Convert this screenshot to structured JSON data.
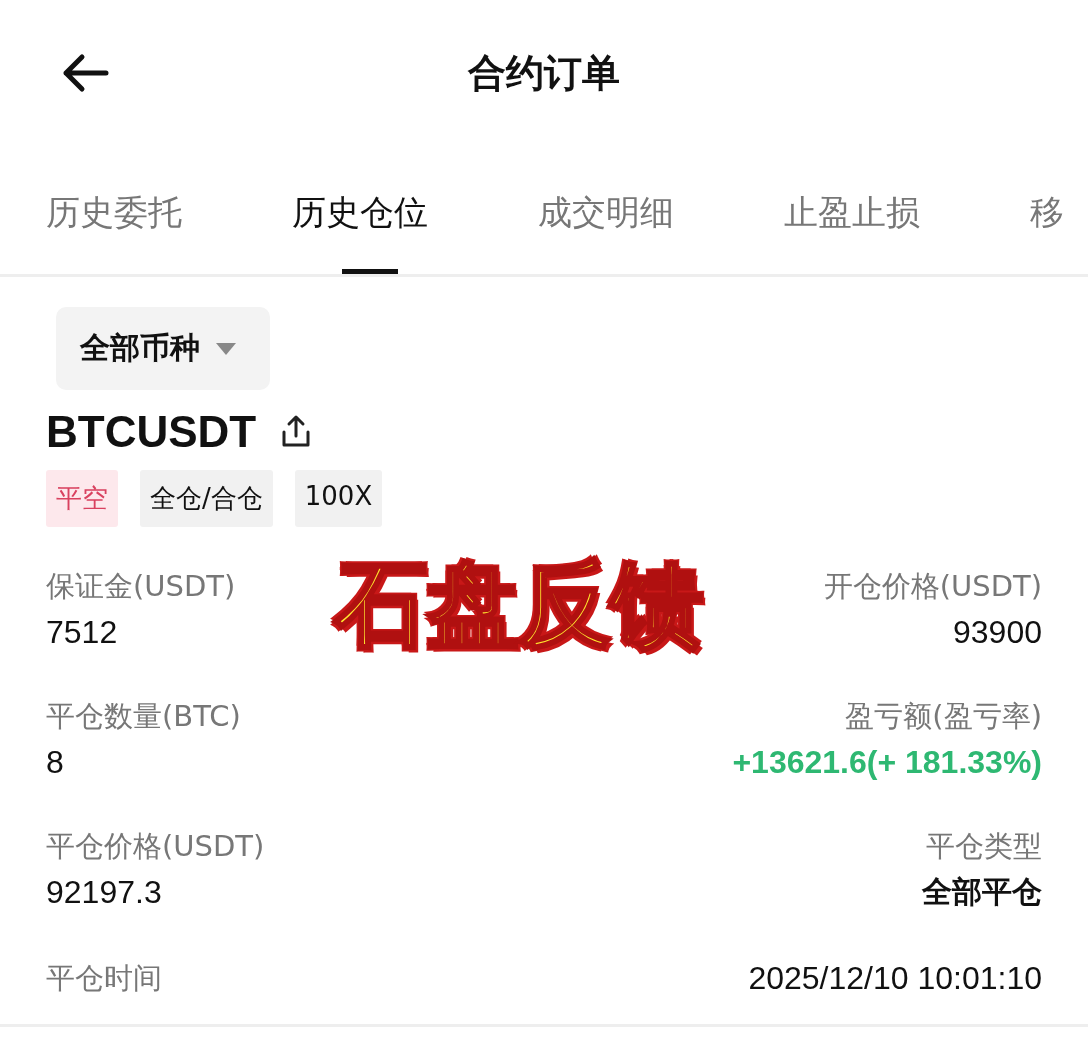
{
  "header": {
    "title": "合约订单"
  },
  "tabs": [
    {
      "label": "历史委托",
      "selected": false
    },
    {
      "label": "历史仓位",
      "selected": true
    },
    {
      "label": "成交明细",
      "selected": false
    },
    {
      "label": "止盈止损",
      "selected": false
    },
    {
      "label": "移",
      "selected": false
    }
  ],
  "filter": {
    "label": "全部币种"
  },
  "position": {
    "symbol": "BTCUSDT",
    "tags": [
      {
        "label": "平空",
        "kind": "side"
      },
      {
        "label": "全仓/合仓",
        "kind": "plain"
      },
      {
        "label": "100X",
        "kind": "plain"
      }
    ],
    "fields": [
      {
        "label": "保证金(USDT)",
        "value": "7512",
        "kind": "plain"
      },
      {
        "label": "开仓价格(USDT)",
        "value": "93900",
        "kind": "plain"
      },
      {
        "label": "平仓数量(BTC)",
        "value": "8",
        "kind": "plain"
      },
      {
        "label": "盈亏额(盈亏率)",
        "value": "+13621.6(+ 181.33%)",
        "kind": "gain"
      },
      {
        "label": "平仓价格(USDT)",
        "value": "92197.3",
        "kind": "plain"
      },
      {
        "label": "平仓类型",
        "value": "全部平仓",
        "kind": "strong"
      }
    ],
    "close_time": {
      "label": "平仓时间",
      "value": "2025/12/10 10:01:10"
    }
  },
  "overlay_caption": "石盘反馈"
}
